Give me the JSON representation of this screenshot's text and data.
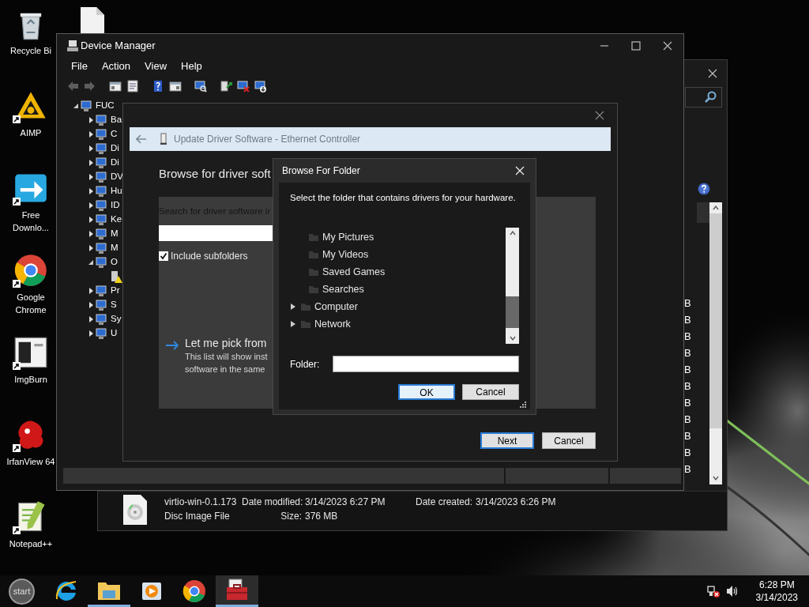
{
  "desktop_icons": [
    {
      "kind": "recycle",
      "label": "Recycle Bi",
      "shortcut": false
    },
    {
      "kind": "aimp",
      "label": "AIMP",
      "shortcut": true
    },
    {
      "kind": "download",
      "label": "Free Downlo...",
      "shortcut": true
    },
    {
      "kind": "chrome",
      "label": "Google Chrome",
      "shortcut": true
    },
    {
      "kind": "imgburn",
      "label": "ImgBurn",
      "shortcut": true
    },
    {
      "kind": "irfanview",
      "label": "IrfanView 64",
      "shortcut": true
    },
    {
      "kind": "notepad",
      "label": "Notepad++",
      "shortcut": true
    }
  ],
  "desktop_file_icon": {
    "kind": "file"
  },
  "explorer": {
    "column_fragment": [
      "B",
      "B",
      "B",
      "B",
      "B",
      "B",
      "B",
      "B",
      "B",
      "B",
      "B"
    ],
    "details": {
      "name": "virtio-win-0.1.173",
      "type": "Disc Image File",
      "modified_label": "Date modified:",
      "modified": "3/14/2023 6:27 PM",
      "size_label": "Size:",
      "size": "376 MB",
      "created_label": "Date created:",
      "created": "3/14/2023 6:26 PM"
    }
  },
  "device_manager": {
    "title": "Device Manager",
    "menu": [
      "File",
      "Action",
      "View",
      "Help"
    ],
    "toolbar": [
      {
        "kind": "back",
        "disabled": true
      },
      {
        "kind": "forward",
        "disabled": true
      },
      {
        "kind": "console",
        "disabled": false
      },
      {
        "kind": "properties",
        "disabled": false
      },
      {
        "kind": "help",
        "disabled": false
      },
      {
        "kind": "pane",
        "disabled": false
      },
      {
        "kind": "scan",
        "disabled": false
      },
      {
        "kind": "update",
        "disabled": false
      },
      {
        "kind": "uninstall",
        "disabled": false
      },
      {
        "kind": "enable",
        "disabled": false
      }
    ],
    "tree": {
      "label": "FUC",
      "expanded": true,
      "children": [
        {
          "label": "Ba",
          "expanded": false
        },
        {
          "label": "C",
          "expanded": false
        },
        {
          "label": "Di",
          "expanded": false
        },
        {
          "label": "Di",
          "expanded": false
        },
        {
          "label": "DV",
          "expanded": false
        },
        {
          "label": "Hu",
          "expanded": false
        },
        {
          "label": "ID",
          "expanded": false
        },
        {
          "label": "Ke",
          "expanded": false
        },
        {
          "label": "M",
          "expanded": false
        },
        {
          "label": "M",
          "expanded": false
        },
        {
          "label": "O",
          "expanded": true,
          "children": [
            {
              "warning": true
            }
          ]
        },
        {
          "label": "Pr",
          "expanded": false
        },
        {
          "label": "S",
          "expanded": false
        },
        {
          "label": "Sy",
          "expanded": false
        },
        {
          "label": "U",
          "expanded": false
        }
      ]
    }
  },
  "update_driver": {
    "title": "Update Driver Software - Ethernet Controller",
    "heading": "Browse for driver soft",
    "search_label": "Search for driver software ir",
    "include_subfolders": {
      "label": "Include subfolders",
      "checked": true
    },
    "pick": {
      "title": "Let me pick from",
      "lines": [
        "This list will show inst",
        "software in the same"
      ]
    },
    "buttons": [
      {
        "label": "Next",
        "default": true
      },
      {
        "label": "Cancel",
        "default": false
      }
    ]
  },
  "browse_folder": {
    "title": "Browse For Folder",
    "description": "Select the folder that contains drivers for your hardware.",
    "tree": [
      {
        "children": [
          {
            "label": "My Pictures"
          },
          {
            "label": "My Videos"
          },
          {
            "label": "Saved Games"
          },
          {
            "label": "Searches"
          }
        ]
      },
      {
        "label": "Computer",
        "expanded": false
      },
      {
        "label": "Network",
        "expanded": false
      }
    ],
    "folder_label": "Folder:",
    "buttons": [
      {
        "label": "OK",
        "default": true
      },
      {
        "label": "Cancel",
        "default": false
      }
    ]
  },
  "taskbar": {
    "start_label": "start",
    "apps": [
      {
        "kind": "ie",
        "running": false,
        "selected": false
      },
      {
        "kind": "explorer",
        "running": true,
        "selected": false
      },
      {
        "kind": "media",
        "running": false,
        "selected": false
      },
      {
        "kind": "chrome",
        "running": false,
        "selected": false
      },
      {
        "kind": "toolbox",
        "running": true,
        "selected": true
      }
    ],
    "clock": {
      "time": "6:28 PM",
      "date": "3/14/2023"
    }
  }
}
